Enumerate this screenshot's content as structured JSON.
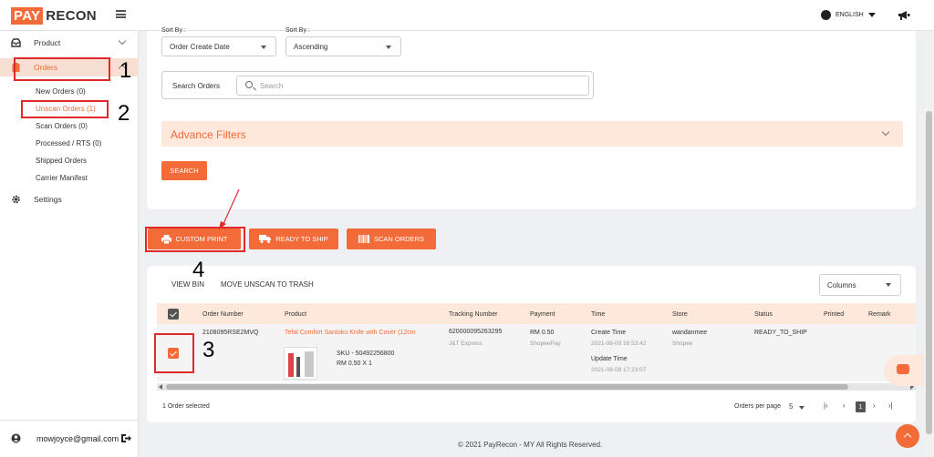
{
  "brand": {
    "part1": "PAY",
    "part2": "RECON"
  },
  "header": {
    "language": "ENGLISH"
  },
  "sidebar": {
    "items": [
      {
        "label": "Product"
      },
      {
        "label": "Orders"
      },
      {
        "label": "Settings"
      }
    ],
    "orders_sub": [
      "New Orders (0)",
      "Unscan Orders (1)",
      "Scan Orders (0)",
      "Processed / RTS (0)",
      "Shipped Orders",
      "Carrier Manifest"
    ],
    "user_email": "mowjoyce@gmail.com"
  },
  "filters": {
    "sort_by_label": "Sort By :",
    "sort_by_value": "Order Create Date",
    "sort_dir_label": "Sort By :",
    "sort_dir_value": "Ascending",
    "search_label": "Search Orders",
    "search_placeholder": "Search",
    "advance_filters": "Advance Filters",
    "search_button": "SEARCH"
  },
  "actions": {
    "custom_print": "CUSTOM PRINT",
    "ready_to_ship": "READY TO SHIP",
    "scan_orders": "SCAN ORDERS"
  },
  "table": {
    "view_bin": "VIEW BIN",
    "move_to_trash": "MOVE UNSCAN TO TRASH",
    "columns_label": "Columns",
    "headers": [
      "Order Number",
      "Product",
      "Tracking Number",
      "Payment",
      "Time",
      "Store",
      "Status",
      "Printed",
      "Remark"
    ],
    "row": {
      "order_number": "2108095RSE2MVQ",
      "product_name": "Tefal Comfort Santoku Knife with Cover (12cm",
      "sku": "SKU - 50492256800",
      "price_qty": "RM 0.50 X 1",
      "tracking_number": "620000095263295",
      "carrier": "J&T Express",
      "payment": "RM 0.50",
      "payment_method": "ShopeePay",
      "create_label": "Create Time",
      "create_time": "2021-08-09 16:53:42",
      "update_label": "Update Time",
      "update_time": "2021-08-09 17:23:07",
      "store": "wandanmee",
      "platform": "Shopee",
      "status": "READY_TO_SHIP"
    },
    "selected_count": "1 Order selected",
    "orders_per_page_label": "Orders per page",
    "orders_per_page": "5",
    "current_page": "1"
  },
  "annotations": {
    "n1": "1",
    "n2": "2",
    "n3": "3",
    "n4": "4"
  },
  "footer": "© 2021 PayRecon - MY All Rights Reserved.",
  "colors": {
    "accent": "#f26b38",
    "accent_light": "#fde8db",
    "annotation": "#e02a2a"
  }
}
